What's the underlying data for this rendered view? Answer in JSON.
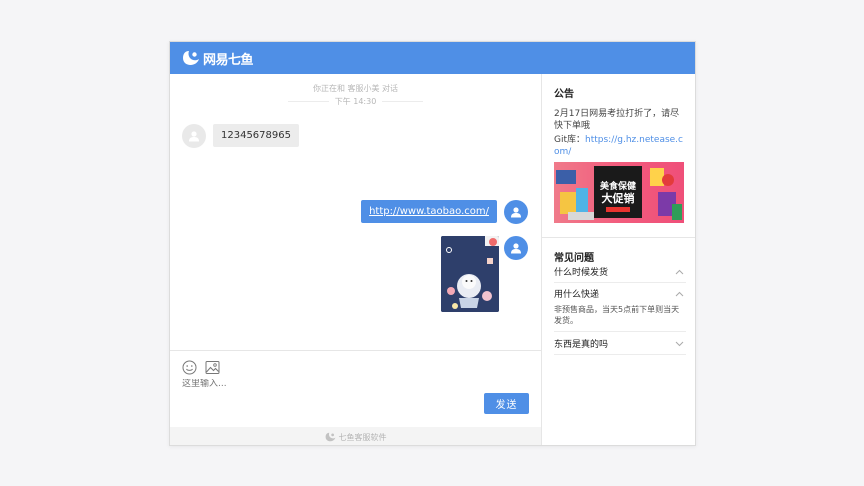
{
  "header": {
    "brand": "网易七鱼"
  },
  "chat": {
    "system_notice": "你正在和 客服小美 对话",
    "time_label": "下午 14:30",
    "messages": [
      {
        "side": "left",
        "text": "12345678965"
      },
      {
        "side": "right",
        "text": "http://www.taobao.com/"
      },
      {
        "side": "right",
        "type": "image"
      }
    ]
  },
  "input": {
    "placeholder": "这里输入...",
    "send_label": "发送"
  },
  "footer": {
    "label": "七鱼客服软件"
  },
  "sidebar": {
    "notice_title": "公告",
    "notice_text": "2月17日网易考拉打折了，请尽快下单哦",
    "git_label": "Git库：",
    "git_link": "https://g.hz.netease.com/",
    "banner": {
      "line1": "美食保健",
      "line2": "大促销"
    },
    "faq_title": "常见问题",
    "faq": [
      {
        "q": "什么时候发货",
        "expanded": false,
        "chevron": "chevron-up-icon"
      },
      {
        "q": "用什么快递",
        "expanded": true,
        "a": "非预售商品，当天5点前下单则当天发货。",
        "chevron": "chevron-up-icon"
      },
      {
        "q": "东西是真的吗",
        "expanded": false,
        "chevron": "chevron-down-icon"
      }
    ]
  },
  "colors": {
    "accent": "#4f8fe6",
    "bubble_grey": "#ececec",
    "background": "#f5f5f7"
  }
}
